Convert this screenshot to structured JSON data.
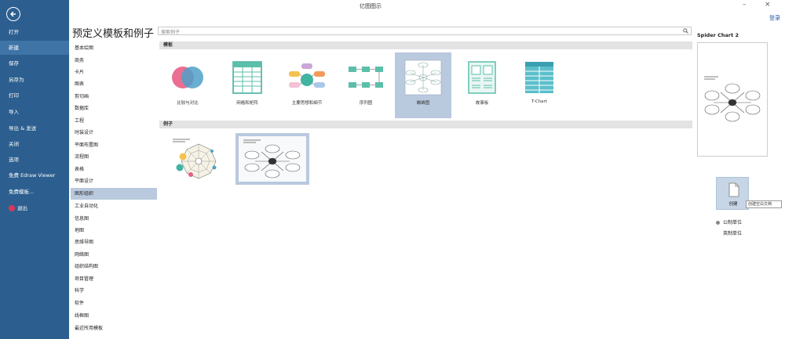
{
  "window": {
    "title": "亿图图示",
    "minimize": "–",
    "close": "×",
    "login": "登录"
  },
  "sidebar": {
    "items": [
      {
        "label": "打开"
      },
      {
        "label": "新建"
      },
      {
        "label": "保存"
      },
      {
        "label": "另存为"
      },
      {
        "label": "打印"
      },
      {
        "label": "导入"
      },
      {
        "label": "导出 & 发送"
      },
      {
        "label": "关闭"
      },
      {
        "label": "选项"
      },
      {
        "label": "免费 Edraw Viewer"
      },
      {
        "label": "免费模板..."
      },
      {
        "label": "退出"
      }
    ]
  },
  "page": {
    "heading": "预定义模板和例子"
  },
  "categories": [
    {
      "label": "基本绘图"
    },
    {
      "label": "商务"
    },
    {
      "label": "卡片"
    },
    {
      "label": "图表"
    },
    {
      "label": "剪切画"
    },
    {
      "label": "数据库"
    },
    {
      "label": "工程"
    },
    {
      "label": "时装设计"
    },
    {
      "label": "平面布置图"
    },
    {
      "label": "流程图"
    },
    {
      "label": "表格"
    },
    {
      "label": "平面设计"
    },
    {
      "label": "图形组织"
    },
    {
      "label": "工业自动化"
    },
    {
      "label": "信息图"
    },
    {
      "label": "地图"
    },
    {
      "label": "思维导图"
    },
    {
      "label": "网络图"
    },
    {
      "label": "组织结构图"
    },
    {
      "label": "项目管理"
    },
    {
      "label": "科学"
    },
    {
      "label": "软件"
    },
    {
      "label": "线框图"
    },
    {
      "label": "最近所用模板"
    }
  ],
  "search": {
    "placeholder": "搜索例子"
  },
  "templates": {
    "section_label": "模板",
    "items": [
      {
        "label": "比较与对比"
      },
      {
        "label": "网格和矩阵"
      },
      {
        "label": "主要思想和细节"
      },
      {
        "label": "序列图"
      },
      {
        "label": "蜘蛛图"
      },
      {
        "label": "故事板"
      },
      {
        "label": "T-Chart"
      }
    ]
  },
  "examples": {
    "section_label": "例子"
  },
  "preview": {
    "title": "Spider Chart 2"
  },
  "create": {
    "label": "创建",
    "tooltip": "创建空白文档"
  },
  "units": {
    "metric": "公制单位",
    "imperial": "英制单位"
  },
  "colors": {
    "sidebar": "#2c5f8f",
    "selection": "#b9c9de",
    "accent": "#d9365a"
  }
}
